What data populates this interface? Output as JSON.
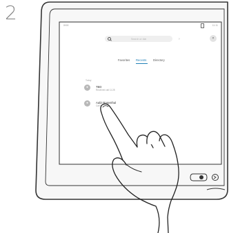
{
  "step": {
    "number": "2"
  },
  "screen": {
    "status_left": "XXX",
    "status_right": "11:11"
  },
  "search": {
    "placeholder": "Search or dial"
  },
  "tabs": [
    {
      "label": "Favorites"
    },
    {
      "label": "Recents",
      "selected": true
    },
    {
      "label": "Directory"
    }
  ],
  "recents": {
    "section_label": "Today",
    "items": [
      {
        "name": "TBD",
        "detail": "Received call 11:28"
      },
      {
        "name": "Aaliz Rosenthal",
        "detail": "Call back"
      }
    ]
  },
  "icons": {
    "search": "search-icon",
    "close": "close-icon",
    "dial": "dial-icon",
    "avatar": "user-icon",
    "pointer": "hand-pointer"
  },
  "colors": {
    "accent": "#1f7fb6",
    "frame": "#333333",
    "step_number": "#8a8a8a"
  }
}
